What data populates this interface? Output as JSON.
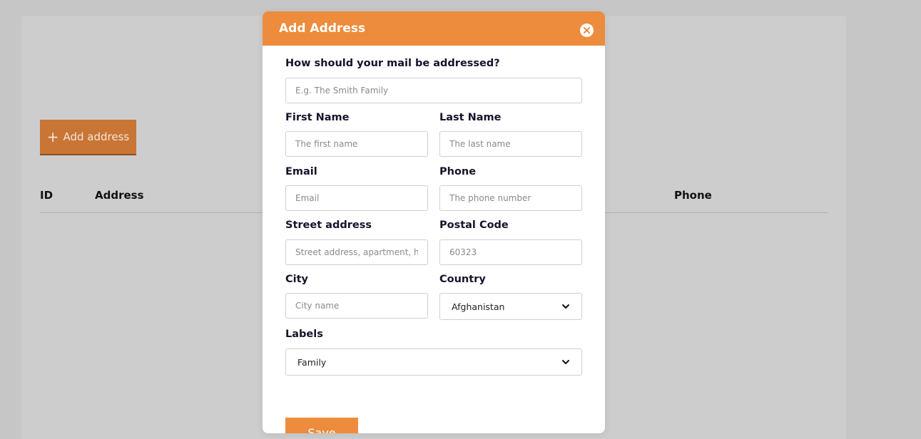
{
  "background": {
    "add_button_label": "Add address",
    "table_headers": {
      "id": "ID",
      "address": "Address",
      "phone": "Phone"
    }
  },
  "modal": {
    "title": "Add Address",
    "addressed_label": "How should your mail be addressed?",
    "addressed_placeholder": "E.g. The Smith Family",
    "first_name_label": "First Name",
    "first_name_placeholder": "The first name",
    "last_name_label": "Last Name",
    "last_name_placeholder": "The last name",
    "email_label": "Email",
    "email_placeholder": "Email",
    "phone_label": "Phone",
    "phone_placeholder": "The phone number",
    "street_label": "Street address",
    "street_placeholder": "Street address, apartment, hou",
    "postal_label": "Postal Code",
    "postal_placeholder": "60323",
    "city_label": "City",
    "city_placeholder": "City name",
    "country_label": "Country",
    "country_value": "Afghanistan",
    "labels_label": "Labels",
    "labels_value": "Family",
    "save_label": "Save"
  },
  "colors": {
    "accent": "#ec8c3c",
    "background_button": "#c97535",
    "overlay": "#c5c6c5"
  }
}
